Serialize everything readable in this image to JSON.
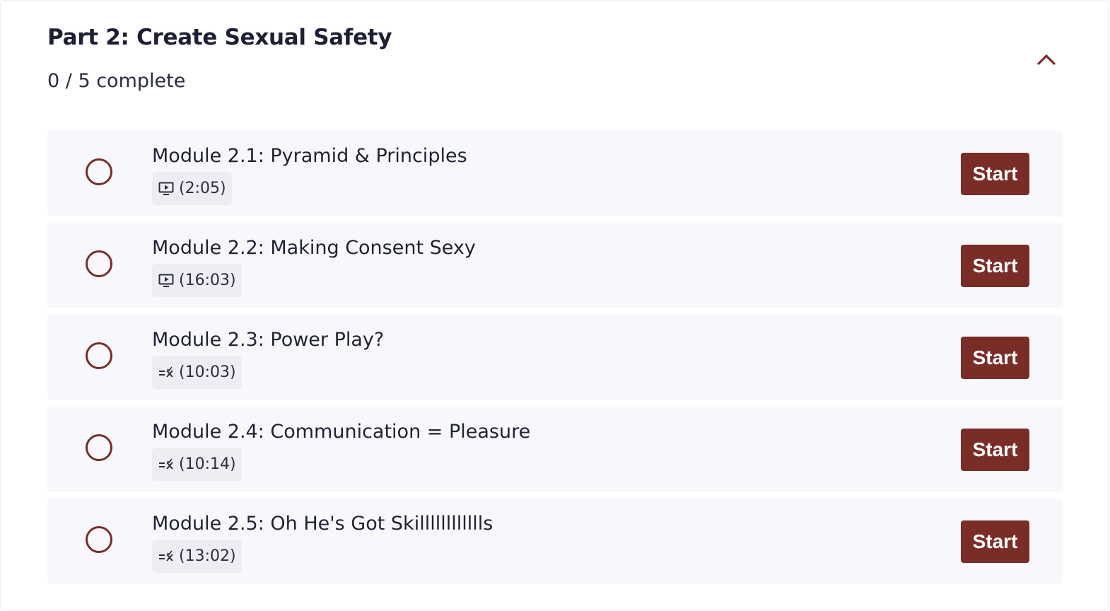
{
  "section": {
    "title": "Part 2: Create Sexual Safety",
    "progress": "0 / 5 complete",
    "collapse_icon": "chevron-up-icon"
  },
  "colors": {
    "accent": "#7a2c26",
    "row_background": "#f8f8fc",
    "badge_background": "#ededf3",
    "title_text": "#1c1f35"
  },
  "modules": [
    {
      "title": "Module 2.1: Pyramid & Principles",
      "duration": "(2:05)",
      "type_icon": "video-icon",
      "completed": false,
      "button_label": "Start"
    },
    {
      "title": "Module 2.2: Making Consent Sexy",
      "duration": "(16:03)",
      "type_icon": "video-icon",
      "completed": false,
      "button_label": "Start"
    },
    {
      "title": "Module 2.3: Power Play?",
      "duration": "(10:03)",
      "type_icon": "quiz-icon",
      "completed": false,
      "button_label": "Start"
    },
    {
      "title": "Module 2.4: Communication = Pleasure",
      "duration": "(10:14)",
      "type_icon": "quiz-icon",
      "completed": false,
      "button_label": "Start"
    },
    {
      "title": "Module 2.5: Oh He's Got Skilllllllllllls",
      "duration": "(13:02)",
      "type_icon": "quiz-icon",
      "completed": false,
      "button_label": "Start"
    }
  ]
}
